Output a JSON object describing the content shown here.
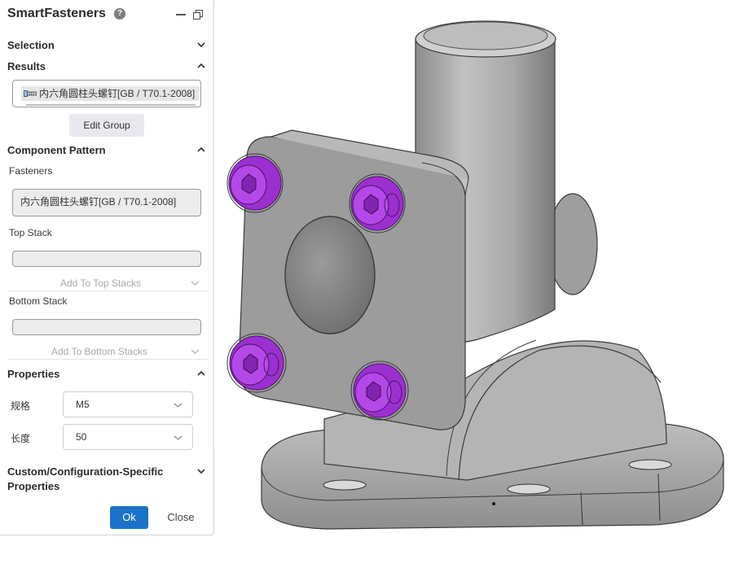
{
  "panel": {
    "title": "SmartFasteners",
    "help_glyph": "?",
    "icons": [
      "help-icon",
      "minimize-icon",
      "restore-icon"
    ]
  },
  "sections": {
    "selection": {
      "label": "Selection",
      "state": "collapsed"
    },
    "results": {
      "label": "Results",
      "state": "expanded",
      "item": "内六角圆柱头螺钉[GB / T70.1-2008]",
      "edit_group_label": "Edit Group"
    },
    "component_pattern": {
      "label": "Component Pattern",
      "state": "expanded",
      "fasteners_label": "Fasteners",
      "fasteners_value": "内六角圆柱头螺钉[GB / T70.1-2008]",
      "top_stack_label": "Top Stack",
      "add_top_label": "Add To Top Stacks",
      "bottom_stack_label": "Bottom Stack",
      "add_bottom_label": "Add To Bottom Stacks"
    },
    "properties": {
      "label": "Properties",
      "state": "expanded",
      "rows": [
        {
          "label": "规格",
          "value": "M5"
        },
        {
          "label": "长度",
          "value": "50"
        }
      ]
    },
    "custom": {
      "label": "Custom/Configuration-Specific Properties",
      "state": "collapsed"
    }
  },
  "buttons": {
    "ok": "Ok",
    "close": "Close"
  },
  "colors": {
    "accent": "#1a73c9",
    "fastener": "#9b2fd0",
    "model": "#a3a3a3"
  }
}
